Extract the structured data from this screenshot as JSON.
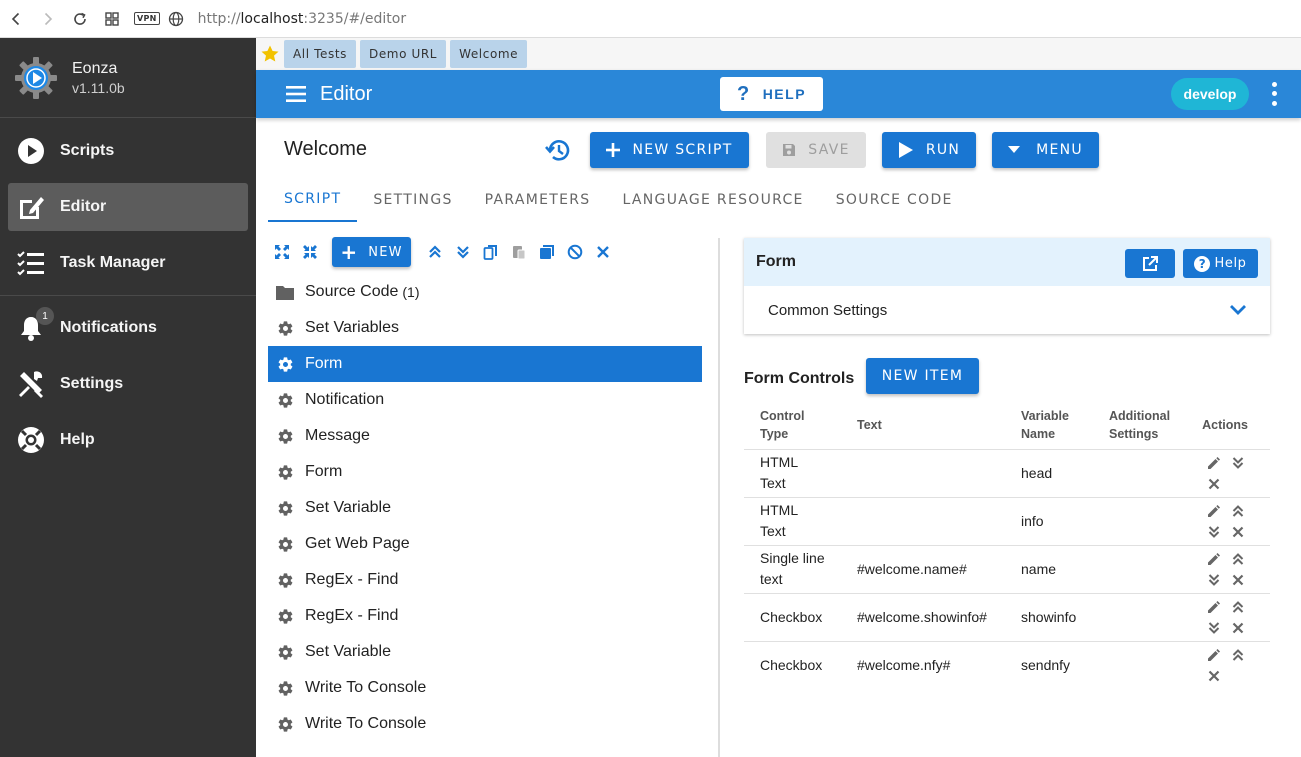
{
  "browser": {
    "url_prefix": "http://",
    "url_host": "localhost",
    "url_rest": ":3235/#/editor",
    "vpn_label": "VPN"
  },
  "sidebar": {
    "app_name": "Eonza",
    "version": "v1.11.0b",
    "items": [
      {
        "label": "Scripts",
        "icon": "play-circle-icon"
      },
      {
        "label": "Editor",
        "icon": "edit-icon"
      },
      {
        "label": "Task Manager",
        "icon": "task-list-icon"
      },
      {
        "label": "Notifications",
        "icon": "bell-icon",
        "badge": "1"
      },
      {
        "label": "Settings",
        "icon": "tools-icon"
      },
      {
        "label": "Help",
        "icon": "lifebuoy-icon"
      }
    ]
  },
  "bookmarks": [
    "All Tests",
    "Demo URL",
    "Welcome"
  ],
  "appbar": {
    "title": "Editor",
    "help_label": "HELP",
    "branch_chip": "develop"
  },
  "editor": {
    "script_title": "Welcome",
    "buttons": {
      "new_script": "NEW SCRIPT",
      "save": "SAVE",
      "run": "RUN",
      "menu": "MENU"
    },
    "tabs": [
      "SCRIPT",
      "SETTINGS",
      "PARAMETERS",
      "LANGUAGE RESOURCE",
      "SOURCE CODE"
    ],
    "active_tab": "SCRIPT",
    "tree_new_label": "NEW",
    "tree": [
      {
        "label": "Source Code",
        "count": "(1)",
        "icon": "folder-icon"
      },
      {
        "label": "Set Variables",
        "icon": "gear-icon"
      },
      {
        "label": "Form",
        "icon": "gear-icon",
        "active": true
      },
      {
        "label": "Notification",
        "icon": "gear-icon"
      },
      {
        "label": "Message",
        "icon": "gear-icon"
      },
      {
        "label": "Form",
        "icon": "gear-icon"
      },
      {
        "label": "Set Variable",
        "icon": "gear-icon"
      },
      {
        "label": "Get Web Page",
        "icon": "gear-icon"
      },
      {
        "label": "RegEx - Find",
        "icon": "gear-icon"
      },
      {
        "label": "RegEx - Find",
        "icon": "gear-icon"
      },
      {
        "label": "Set Variable",
        "icon": "gear-icon"
      },
      {
        "label": "Write To Console",
        "icon": "gear-icon"
      },
      {
        "label": "Write To Console",
        "icon": "gear-icon"
      }
    ]
  },
  "form_panel": {
    "title": "Form",
    "help_label": "Help",
    "common_settings": "Common Settings",
    "controls_title": "Form Controls",
    "new_item_label": "NEW ITEM",
    "columns": [
      "Control Type",
      "Text",
      "Variable Name",
      "Additional Settings",
      "Actions"
    ],
    "rows": [
      {
        "type": "HTML Text",
        "text": "",
        "var": "head",
        "add": "",
        "actions": [
          "edit",
          "down",
          "delete"
        ]
      },
      {
        "type": "HTML Text",
        "text": "",
        "var": "info",
        "add": "",
        "actions": [
          "edit",
          "up",
          "down",
          "delete"
        ]
      },
      {
        "type": "Single line text",
        "text": "#welcome.name#",
        "var": "name",
        "add": "",
        "actions": [
          "edit",
          "up",
          "down",
          "delete"
        ]
      },
      {
        "type": "Checkbox",
        "text": "#welcome.showinfo#",
        "var": "showinfo",
        "add": "",
        "actions": [
          "edit",
          "up",
          "down",
          "delete"
        ]
      },
      {
        "type": "Checkbox",
        "text": "#welcome.nfy#",
        "var": "sendnfy",
        "add": "",
        "actions": [
          "edit",
          "up",
          "delete"
        ]
      }
    ]
  },
  "colors": {
    "sidebar_bg": "#333333",
    "primary": "#1976d2",
    "appbar": "#2a87d8",
    "chip": "#1fb6d6",
    "bookmark_chip": "#b9d3ea",
    "panel_head": "#e3f2fd"
  }
}
